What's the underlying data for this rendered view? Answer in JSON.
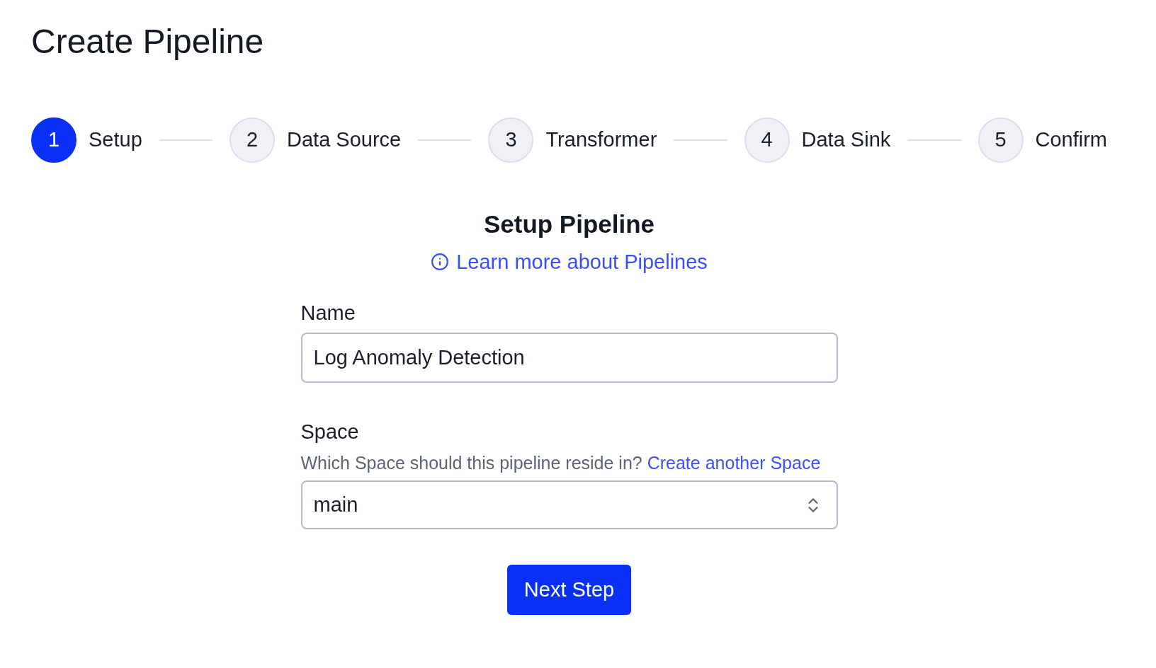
{
  "page": {
    "title": "Create Pipeline"
  },
  "steps": [
    {
      "number": "1",
      "label": "Setup",
      "selected": true
    },
    {
      "number": "2",
      "label": "Data Source",
      "selected": false
    },
    {
      "number": "3",
      "label": "Transformer",
      "selected": false
    },
    {
      "number": "4",
      "label": "Data Sink",
      "selected": false
    },
    {
      "number": "5",
      "label": "Confirm",
      "selected": false
    }
  ],
  "form": {
    "heading": "Setup Pipeline",
    "help_link": "Learn more about Pipelines",
    "fields": [
      {
        "kind": "text",
        "label": "Name",
        "value": "Log Anomaly Detection"
      },
      {
        "kind": "select",
        "label": "Space",
        "description": "Which Space should this pipeline reside in?",
        "description_link": "Create another Space",
        "value": "main"
      }
    ],
    "submit": "Next Step"
  }
}
